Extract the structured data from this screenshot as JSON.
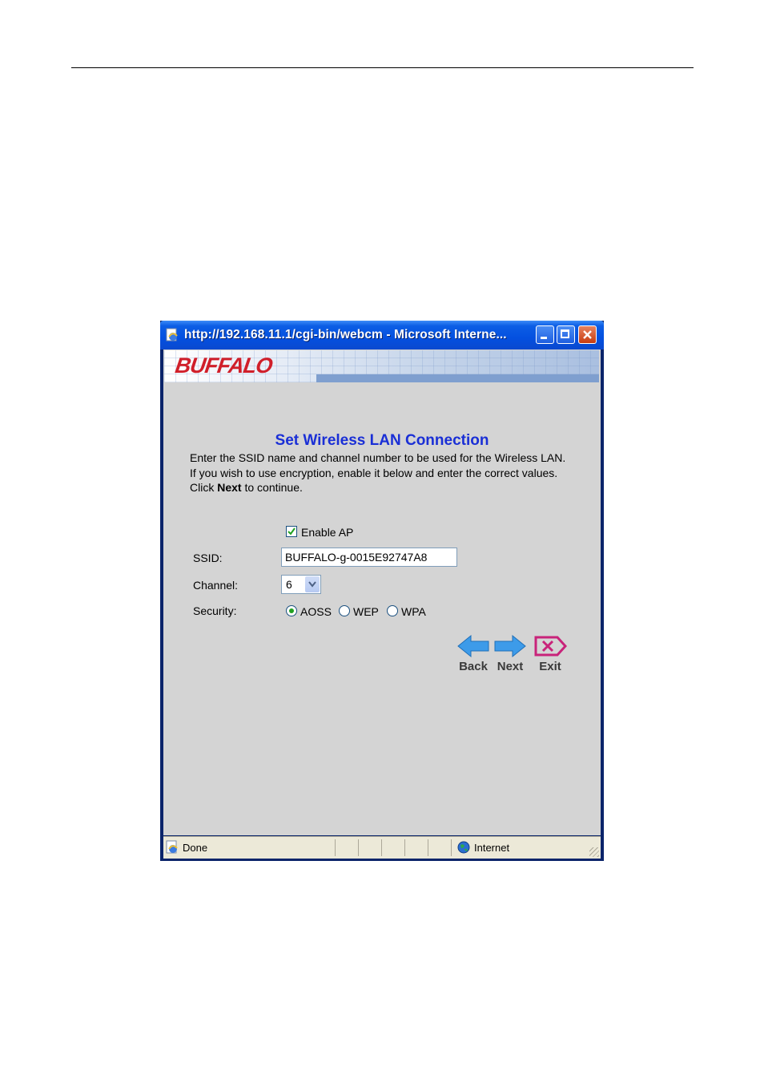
{
  "window": {
    "title": "http://192.168.11.1/cgi-bin/webcm - Microsoft Interne..."
  },
  "banner": {
    "logo": "BUFFALO"
  },
  "form": {
    "heading": "Set Wireless LAN Connection",
    "description_before": "Enter the SSID name and channel number to be used for the Wireless LAN. If you wish to use encryption, enable it below and enter the correct values. Click ",
    "description_bold": "Next",
    "description_after": " to continue.",
    "enable_ap_label": "Enable AP",
    "enable_ap_checked": true,
    "ssid_label": "SSID:",
    "ssid_value": "BUFFALO-g-0015E92747A8",
    "channel_label": "Channel:",
    "channel_value": "6",
    "security_label": "Security:",
    "security_options": [
      "AOSS",
      "WEP",
      "WPA"
    ],
    "security_selected": "AOSS"
  },
  "nav": {
    "back_label": "Back",
    "next_label": "Next",
    "exit_label": "Exit"
  },
  "statusbar": {
    "status_text": "Done",
    "zone_text": "Internet"
  },
  "colors": {
    "heading": "#1a2fd6",
    "logo": "#d01f2a",
    "arrow": "#3d9be9",
    "exit": "#c8237a"
  }
}
